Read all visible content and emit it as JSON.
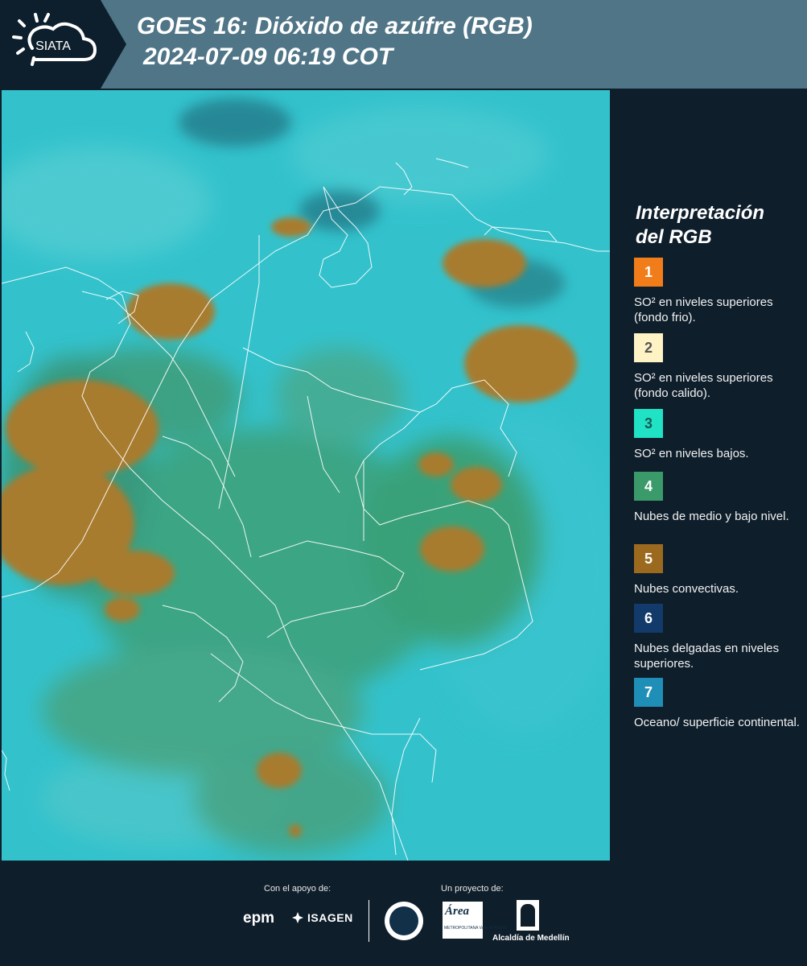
{
  "header": {
    "logo_text": "SIATA",
    "title_line1": "GOES 16: Dióxido de azúfre (RGB)",
    "title_line2": "2024-07-09 06:19 COT"
  },
  "map": {
    "background_color": "#2bbcc7",
    "convective_color": "#a77b2e",
    "low_cloud_color": "#3f9a5a",
    "border_color": "#ffffff"
  },
  "legend": {
    "title_line1": "Interpretación",
    "title_line2": "del RGB",
    "items": [
      {
        "number": "1",
        "color": "#f07d1a",
        "text_color": "#ffffff",
        "label": "SO² en niveles superiores (fondo frio)."
      },
      {
        "number": "2",
        "color": "#fdf3c4",
        "text_color": "#555555",
        "label": "SO² en niveles superiores (fondo calido)."
      },
      {
        "number": "3",
        "color": "#1fe3c4",
        "text_color": "#1a5a55",
        "label": "SO² en niveles bajos."
      },
      {
        "number": "4",
        "color": "#3a9a6a",
        "text_color": "#ffffff",
        "label": "Nubes de medio y bajo nivel."
      },
      {
        "number": "5",
        "color": "#9c6a1e",
        "text_color": "#ffffff",
        "label": "Nubes convectivas."
      },
      {
        "number": "6",
        "color": "#123a6a",
        "text_color": "#ffffff",
        "label": "Nubes delgadas en niveles superiores."
      },
      {
        "number": "7",
        "color": "#1f8fb8",
        "text_color": "#ffffff",
        "label": "Oceano/ superficie continental."
      }
    ]
  },
  "footer": {
    "support_label": "Con el apoyo de:",
    "project_label": "Un proyecto de:",
    "epm_text": "epm",
    "isagen_text": "ISAGEN",
    "area_text": "Área",
    "area_sub": "METROPOLITANA Valle de Aburrá",
    "alcaldia_text": "Alcaldía de Medellín"
  }
}
